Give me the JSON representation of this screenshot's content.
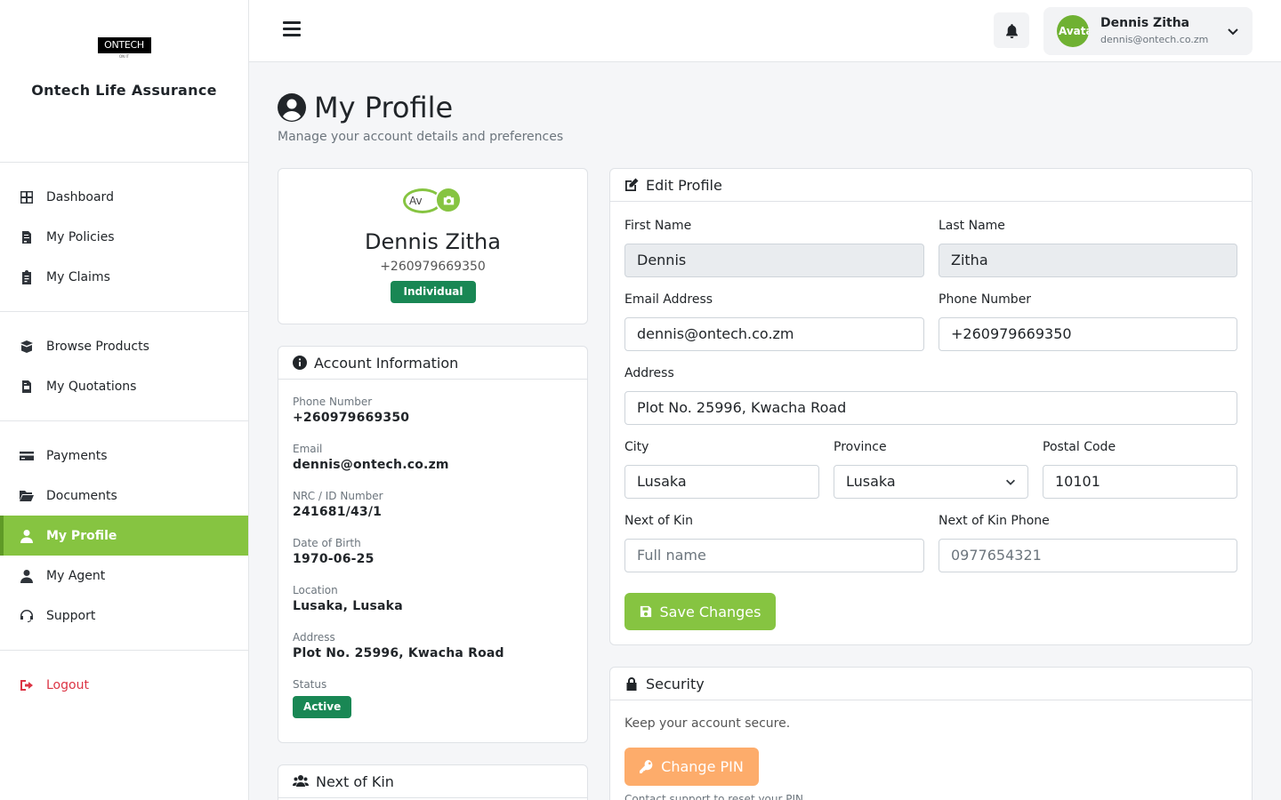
{
  "brand": {
    "logo_text": "ONTECH",
    "logo_sub": "ON IT",
    "name": "Ontech Life Assurance"
  },
  "sidebar": {
    "items": [
      {
        "label": "Dashboard",
        "icon": "grid-icon"
      },
      {
        "label": "My Policies",
        "icon": "file-contract-icon"
      },
      {
        "label": "My Claims",
        "icon": "clipboard-icon"
      },
      {
        "label": "Browse Products",
        "icon": "box-open-icon"
      },
      {
        "label": "My Quotations",
        "icon": "file-invoice-icon"
      },
      {
        "label": "Payments",
        "icon": "credit-card-icon"
      },
      {
        "label": "Documents",
        "icon": "folder-open-icon"
      },
      {
        "label": "My Profile",
        "icon": "user-icon",
        "active": true
      },
      {
        "label": "My Agent",
        "icon": "user-tie-icon"
      },
      {
        "label": "Support",
        "icon": "headset-icon"
      },
      {
        "label": "Logout",
        "icon": "sign-out-icon"
      }
    ]
  },
  "topbar": {
    "user_name": "Dennis Zitha",
    "user_email": "dennis@ontech.co.zm",
    "avatar_alt": "Avatar"
  },
  "page": {
    "title": "My Profile",
    "subtitle": "Manage your account details and preferences"
  },
  "profile_card": {
    "avatar_alt": "Av",
    "name": "Dennis Zitha",
    "phone": "+260979669350",
    "badge": "Individual"
  },
  "account_info": {
    "title": "Account Information",
    "items": [
      {
        "label": "Phone Number",
        "value": "+260979669350"
      },
      {
        "label": "Email",
        "value": "dennis@ontech.co.zm"
      },
      {
        "label": "NRC / ID Number",
        "value": "241681/43/1"
      },
      {
        "label": "Date of Birth",
        "value": "1970-06-25"
      },
      {
        "label": "Location",
        "value": "Lusaka, Lusaka"
      },
      {
        "label": "Address",
        "value": "Plot No. 25996, Kwacha Road"
      }
    ],
    "status_label": "Status",
    "status_value": "Active"
  },
  "next_of_kin_card": {
    "title": "Next of Kin"
  },
  "edit_profile": {
    "title": "Edit Profile",
    "first_name": {
      "label": "First Name",
      "value": "Dennis"
    },
    "last_name": {
      "label": "Last Name",
      "value": "Zitha"
    },
    "email": {
      "label": "Email Address",
      "value": "dennis@ontech.co.zm"
    },
    "phone": {
      "label": "Phone Number",
      "value": "+260979669350"
    },
    "address": {
      "label": "Address",
      "value": "Plot No. 25996, Kwacha Road"
    },
    "city": {
      "label": "City",
      "value": "Lusaka"
    },
    "province": {
      "label": "Province",
      "value": "Lusaka"
    },
    "postal_code": {
      "label": "Postal Code",
      "value": "10101"
    },
    "next_of_kin": {
      "label": "Next of Kin",
      "placeholder": "Full name"
    },
    "next_of_kin_phone": {
      "label": "Next of Kin Phone",
      "placeholder": "0977654321"
    },
    "save_label": "Save Changes"
  },
  "security": {
    "title": "Security",
    "text": "Keep your account secure.",
    "button_label": "Change PIN",
    "note": "Contact support to reset your PIN."
  },
  "colors": {
    "accent": "#86c441",
    "success": "#198754",
    "warning": "#fdac6b",
    "danger": "#dc3545"
  }
}
